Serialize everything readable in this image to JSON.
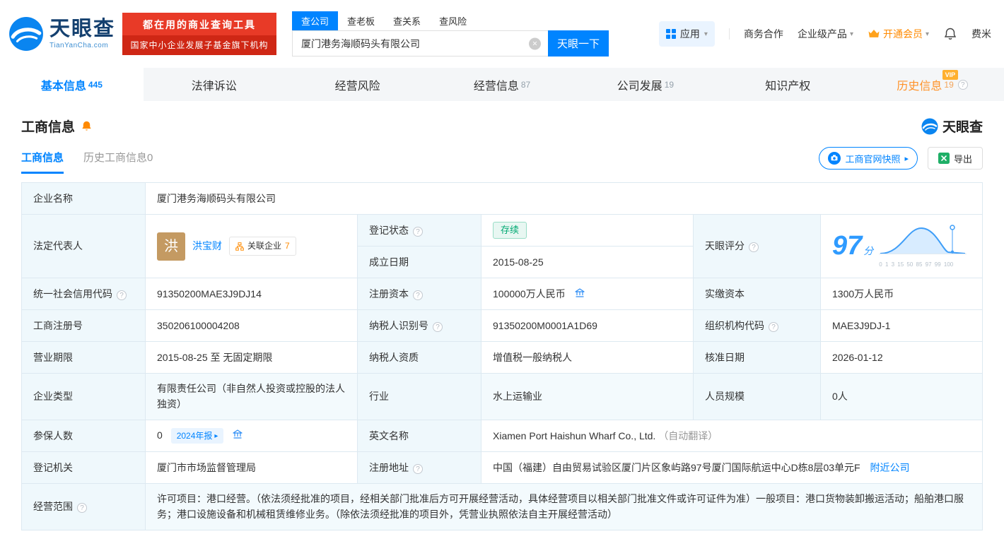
{
  "colors": {
    "primary": "#0084ff",
    "orange": "#ff8a00",
    "green": "#00a972",
    "red": "#e83a27"
  },
  "brand": {
    "name": "天眼查",
    "domain": "TianYanCha.com"
  },
  "header": {
    "slogan_line1": "都在用的商业查询工具",
    "slogan_line2": "国家中小企业发展子基金旗下机构",
    "search": {
      "tabs": [
        {
          "label": "查公司",
          "active": true
        },
        {
          "label": "查老板",
          "active": false
        },
        {
          "label": "查关系",
          "active": false
        },
        {
          "label": "查风险",
          "active": false
        }
      ],
      "value": "厦门港务海顺码头有限公司",
      "button": "天眼一下"
    },
    "nav": {
      "apps": "应用",
      "cooperation": "商务合作",
      "enterprise": "企业级产品",
      "vip": "开通会员",
      "user": "费米"
    }
  },
  "tabs": [
    {
      "label": "基本信息",
      "count": "445"
    },
    {
      "label": "法律诉讼"
    },
    {
      "label": "经营风险"
    },
    {
      "label": "经营信息",
      "count": "87"
    },
    {
      "label": "公司发展",
      "count": "19"
    },
    {
      "label": "知识产权"
    },
    {
      "label": "历史信息",
      "count": "19",
      "vip": "VIP"
    }
  ],
  "section": {
    "title": "工商信息",
    "watermark": "天眼查",
    "subtab_active": "工商信息",
    "subtab_history": "历史工商信息",
    "subtab_history_count": "0",
    "snapshot_button": "工商官网快照",
    "export_button": "导出"
  },
  "fields": {
    "company_name": {
      "label": "企业名称",
      "value": "厦门港务海顺码头有限公司"
    },
    "legal_rep": {
      "label": "法定代表人",
      "avatar": "洪",
      "name": "洪宝财",
      "related_label": "关联企业",
      "related_count": "7"
    },
    "reg_status": {
      "label": "登记状态",
      "value": "存续"
    },
    "establish_date": {
      "label": "成立日期",
      "value": "2015-08-25"
    },
    "score": {
      "label": "天眼评分",
      "value": "97",
      "unit": "分",
      "axis": "0 1 3 15 50 85 97 99 100"
    },
    "credit_code": {
      "label": "统一社会信用代码",
      "value": "91350200MAE3J9DJ14"
    },
    "reg_capital": {
      "label": "注册资本",
      "value": "100000万人民币"
    },
    "paid_capital": {
      "label": "实缴资本",
      "value": "1300万人民币"
    },
    "reg_number": {
      "label": "工商注册号",
      "value": "350206100004208"
    },
    "taxpayer_id": {
      "label": "纳税人识别号",
      "value": "91350200M0001A1D69"
    },
    "org_code": {
      "label": "组织机构代码",
      "value": "MAE3J9DJ-1"
    },
    "business_term": {
      "label": "营业期限",
      "value": "2015-08-25 至 无固定期限"
    },
    "taxpayer_quality": {
      "label": "纳税人资质",
      "value": "增值税一般纳税人"
    },
    "approval_date": {
      "label": "核准日期",
      "value": "2026-01-12"
    },
    "company_type": {
      "label": "企业类型",
      "value": "有限责任公司（非自然人投资或控股的法人独资）"
    },
    "industry": {
      "label": "行业",
      "value": "水上运输业"
    },
    "staff_size": {
      "label": "人员规模",
      "value": "0人"
    },
    "insured": {
      "label": "参保人数",
      "value": "0",
      "report_tag": "2024年报"
    },
    "english_name": {
      "label": "英文名称",
      "value": "Xiamen Port Haishun Wharf Co., Ltd.",
      "note": "（自动翻译）"
    },
    "reg_authority": {
      "label": "登记机关",
      "value": "厦门市市场监督管理局"
    },
    "reg_address": {
      "label": "注册地址",
      "value": "中国（福建）自由贸易试验区厦门片区象屿路97号厦门国际航运中心D栋8层03单元F",
      "nearby": "附近公司"
    },
    "business_scope": {
      "label": "经营范围",
      "value": "许可项目：港口经营。（依法须经批准的项目，经相关部门批准后方可开展经营活动，具体经营项目以相关部门批准文件或许可证件为准）一般项目：港口货物装卸搬运活动；船舶港口服务；港口设施设备和机械租赁维修业务。（除依法须经批准的项目外，凭营业执照依法自主开展经营活动）"
    }
  },
  "icons": {
    "help": "?",
    "caret_down": "▾",
    "arrow_right": "▸",
    "clear": "×"
  }
}
